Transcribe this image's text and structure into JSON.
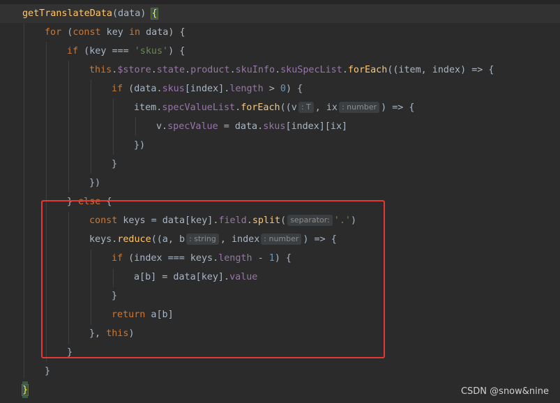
{
  "editor": {
    "lines": [
      [
        {
          "t": "getTranslateData",
          "c": "fn"
        },
        {
          "t": "(data) ",
          "c": "plain"
        },
        {
          "t": "{",
          "c": "brace-hl"
        }
      ],
      [
        {
          "t": "for",
          "c": "kw"
        },
        {
          "t": " (",
          "c": "plain"
        },
        {
          "t": "const",
          "c": "kw"
        },
        {
          "t": " key ",
          "c": "plain"
        },
        {
          "t": "in",
          "c": "kw"
        },
        {
          "t": " data) {",
          "c": "plain"
        }
      ],
      [
        {
          "t": "if",
          "c": "kw"
        },
        {
          "t": " (key === ",
          "c": "plain"
        },
        {
          "t": "'skus'",
          "c": "str"
        },
        {
          "t": ") {",
          "c": "plain"
        }
      ],
      [
        {
          "t": "this",
          "c": "kw"
        },
        {
          "t": ".",
          "c": "plain"
        },
        {
          "t": "$store",
          "c": "prop"
        },
        {
          "t": ".",
          "c": "plain"
        },
        {
          "t": "state",
          "c": "prop"
        },
        {
          "t": ".",
          "c": "plain"
        },
        {
          "t": "product",
          "c": "prop"
        },
        {
          "t": ".",
          "c": "plain"
        },
        {
          "t": "skuInfo",
          "c": "prop"
        },
        {
          "t": ".",
          "c": "plain"
        },
        {
          "t": "skuSpecList",
          "c": "prop"
        },
        {
          "t": ".",
          "c": "plain"
        },
        {
          "t": "forEach",
          "c": "fn"
        },
        {
          "t": "((item, index) => {",
          "c": "plain"
        }
      ],
      [
        {
          "t": "if",
          "c": "kw"
        },
        {
          "t": " (data.",
          "c": "plain"
        },
        {
          "t": "skus",
          "c": "prop"
        },
        {
          "t": "[index].",
          "c": "plain"
        },
        {
          "t": "length",
          "c": "prop"
        },
        {
          "t": " > ",
          "c": "plain"
        },
        {
          "t": "0",
          "c": "num"
        },
        {
          "t": ") {",
          "c": "plain"
        }
      ],
      [
        {
          "t": "item.",
          "c": "plain"
        },
        {
          "t": "specValueList",
          "c": "prop"
        },
        {
          "t": ".",
          "c": "plain"
        },
        {
          "t": "forEach",
          "c": "fn"
        },
        {
          "t": "((v",
          "c": "plain"
        },
        {
          "t": ": T",
          "c": "hint"
        },
        {
          "t": ", ix",
          "c": "plain"
        },
        {
          "t": ": number",
          "c": "hint"
        },
        {
          "t": ") => {",
          "c": "plain"
        }
      ],
      [
        {
          "t": "v.",
          "c": "plain"
        },
        {
          "t": "specValue",
          "c": "prop"
        },
        {
          "t": " = data.",
          "c": "plain"
        },
        {
          "t": "skus",
          "c": "prop"
        },
        {
          "t": "[index][ix]",
          "c": "plain"
        }
      ],
      [
        {
          "t": "})",
          "c": "plain"
        }
      ],
      [
        {
          "t": "}",
          "c": "plain"
        }
      ],
      [
        {
          "t": "})",
          "c": "plain"
        }
      ],
      [
        {
          "t": "} ",
          "c": "plain"
        },
        {
          "t": "else",
          "c": "kw"
        },
        {
          "t": " {",
          "c": "plain"
        }
      ],
      [
        {
          "t": "const",
          "c": "kw"
        },
        {
          "t": " keys = data[key].",
          "c": "plain"
        },
        {
          "t": "field",
          "c": "prop"
        },
        {
          "t": ".",
          "c": "plain"
        },
        {
          "t": "split",
          "c": "fn"
        },
        {
          "t": "(",
          "c": "plain"
        },
        {
          "t": "separator:",
          "c": "hint"
        },
        {
          "t": "'.'",
          "c": "str"
        },
        {
          "t": ")",
          "c": "plain"
        }
      ],
      [
        {
          "t": "keys.",
          "c": "plain"
        },
        {
          "t": "reduce",
          "c": "fn"
        },
        {
          "t": "((a, b",
          "c": "plain"
        },
        {
          "t": ": string",
          "c": "hint"
        },
        {
          "t": ", index",
          "c": "plain"
        },
        {
          "t": ": number",
          "c": "hint"
        },
        {
          "t": ") => {",
          "c": "plain"
        }
      ],
      [
        {
          "t": "if",
          "c": "kw"
        },
        {
          "t": " (index === keys.",
          "c": "plain"
        },
        {
          "t": "length",
          "c": "prop"
        },
        {
          "t": " - ",
          "c": "plain"
        },
        {
          "t": "1",
          "c": "num"
        },
        {
          "t": ") {",
          "c": "plain"
        }
      ],
      [
        {
          "t": "a[b] = data[key].",
          "c": "plain"
        },
        {
          "t": "value",
          "c": "prop"
        }
      ],
      [
        {
          "t": "}",
          "c": "plain"
        }
      ],
      [
        {
          "t": "return",
          "c": "kw"
        },
        {
          "t": " a[b]",
          "c": "plain"
        }
      ],
      [
        {
          "t": "}, ",
          "c": "plain"
        },
        {
          "t": "this",
          "c": "kw"
        },
        {
          "t": ")",
          "c": "plain"
        }
      ],
      [
        {
          "t": "}",
          "c": "plain"
        }
      ],
      [
        {
          "t": "}",
          "c": "plain"
        }
      ],
      [
        {
          "t": "}",
          "c": "brace-hl"
        }
      ]
    ]
  },
  "watermark": "CSDN @snow&nine",
  "colors": {
    "background": "#2b2b2b",
    "keyword": "#cc7832",
    "function": "#ffc66d",
    "property": "#9876aa",
    "string": "#6a8759",
    "number": "#6897bb",
    "text": "#a9b7c6",
    "highlight_box": "#e53935"
  }
}
